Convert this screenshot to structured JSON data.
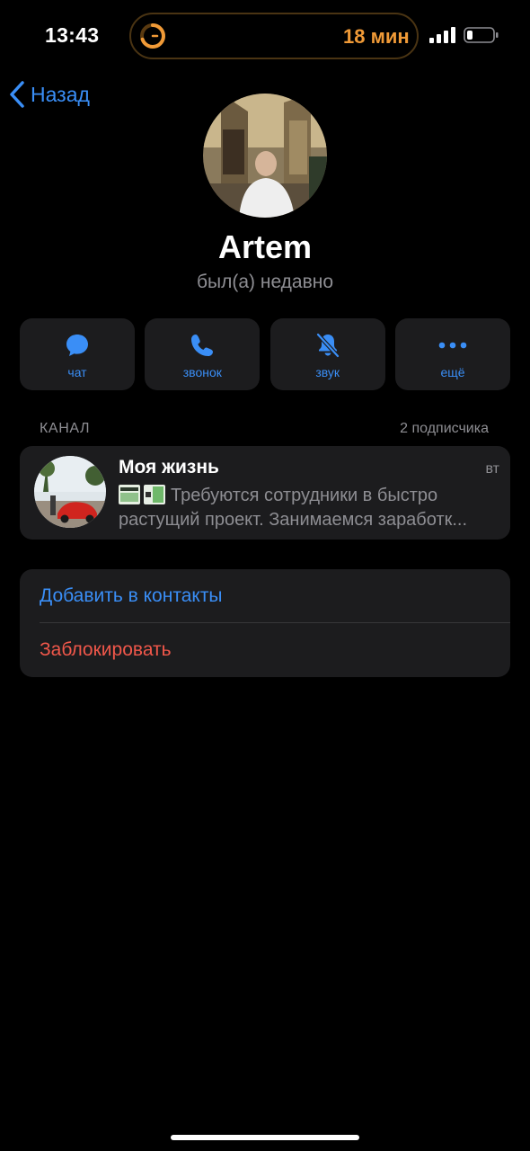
{
  "status_bar": {
    "time": "13:43",
    "timer": "18 мин",
    "accent": "#f09a37"
  },
  "nav": {
    "back_label": "Назад",
    "back_icon": "chevron-left-icon"
  },
  "profile": {
    "name": "Artem",
    "last_seen": "был(а) недавно"
  },
  "actions": [
    {
      "label": "чат",
      "icon": "chat-bubble-icon"
    },
    {
      "label": "звонок",
      "icon": "phone-icon"
    },
    {
      "label": "звук",
      "icon": "bell-slash-icon"
    },
    {
      "label": "ещё",
      "icon": "more-dots-icon"
    }
  ],
  "channel": {
    "section_label": "КАНАЛ",
    "subscribers": "2 подписчика",
    "title": "Моя жизнь",
    "day": "вт",
    "preview": "Требуются сотрудники в быстро растущий проект. Занимаемся заработк..."
  },
  "menu": {
    "add_contact": "Добавить в контакты",
    "block": "Заблокировать"
  },
  "colors": {
    "link": "#3a8ef6",
    "destructive": "#f0574a",
    "card": "#1c1c1e",
    "secondary_text": "#8e8e93"
  }
}
